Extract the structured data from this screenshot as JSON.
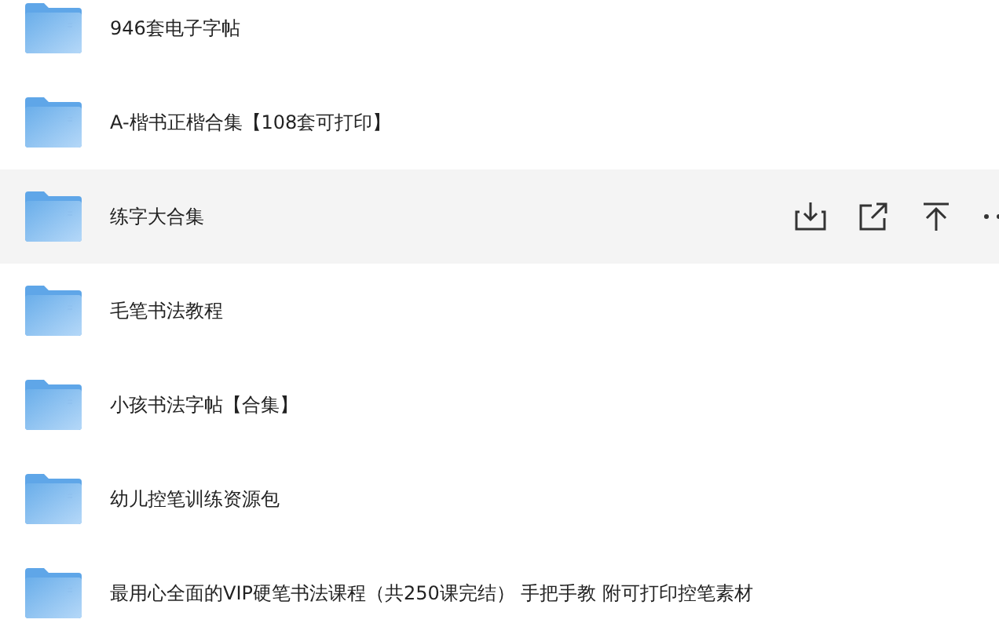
{
  "folders": [
    {
      "name": "946套电子字帖",
      "hovered": false
    },
    {
      "name": "A-楷书正楷合集【108套可打印】",
      "hovered": false
    },
    {
      "name": "练字大合集",
      "hovered": true
    },
    {
      "name": "毛笔书法教程",
      "hovered": false
    },
    {
      "name": "小孩书法字帖【合集】",
      "hovered": false
    },
    {
      "name": "幼儿控笔训练资源包",
      "hovered": false
    },
    {
      "name": "最用心全面的VIP硬笔书法课程（共250课完结） 手把手教 附可打印控笔素材",
      "hovered": false
    }
  ]
}
